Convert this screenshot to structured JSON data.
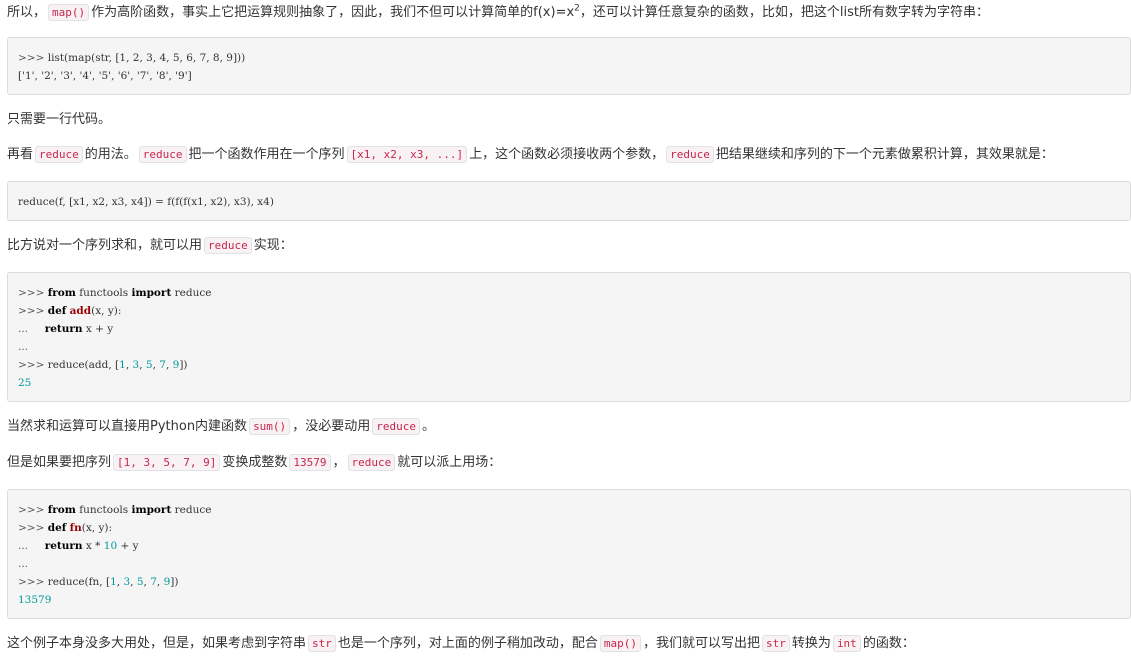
{
  "para1": {
    "a": "所以，",
    "code_map": "map()",
    "b": "作为高阶函数，事实上它把运算规则抽象了，因此，我们不但可以计算简单的f(x)=x",
    "sup": "2",
    "c": "，还可以计算任意复杂的函数，比如，把这个list所有数字转为字符串："
  },
  "code1": {
    "l1": {
      "p": ">>> ",
      "a": "list(map(str, [1, 2, 3, 4, 5, 6, 7, 8, 9]))"
    },
    "l2": "['1', '2', '3', '4', '5', '6', '7', '8', '9']"
  },
  "para2": "只需要一行代码。",
  "para3": {
    "a": "再看",
    "c1": "reduce",
    "b": "的用法。",
    "c2": "reduce",
    "c": "把一个函数作用在一个序列",
    "c3": "[x1, x2, x3, ...]",
    "d": "上，这个函数必须接收两个参数，",
    "c4": "reduce",
    "e": "把结果继续和序列的下一个元素做累积计算，其效果就是："
  },
  "code2": "reduce(f, [x1, x2, x3, x4]) = f(f(f(x1, x2), x3), x4)",
  "para4": {
    "a": "比方说对一个序列求和，就可以用",
    "c1": "reduce",
    "b": "实现："
  },
  "code3": {
    "l1": {
      "p": ">>> ",
      "kw1": "from",
      "m": " functools ",
      "kw2": "import",
      "e": " reduce"
    },
    "l2": {
      "p": ">>> ",
      "kw": "def",
      "fn": "add",
      "e": "(x, y):"
    },
    "l3": {
      "p": "...     ",
      "kw": "return",
      "e": " x + y"
    },
    "l4": {
      "p": "..."
    },
    "l5": {
      "p": ">>> ",
      "a": "reduce(add, [",
      "n1": "1",
      "s1": ", ",
      "n2": "3",
      "s2": ", ",
      "n3": "5",
      "s3": ", ",
      "n4": "7",
      "s4": ", ",
      "n5": "9",
      "e": "])"
    },
    "l6": "25"
  },
  "para5": {
    "a": "当然求和运算可以直接用Python内建函数",
    "c1": "sum()",
    "b": "，没必要动用",
    "c2": "reduce",
    "c": "。"
  },
  "para6": {
    "a": "但是如果要把序列",
    "c1": "[1, 3, 5, 7, 9]",
    "b": "变换成整数",
    "c2": "13579",
    "c": "，",
    "c3": "reduce",
    "d": "就可以派上用场："
  },
  "code4": {
    "l1": {
      "p": ">>> ",
      "kw1": "from",
      "m": " functools ",
      "kw2": "import",
      "e": " reduce"
    },
    "l2": {
      "p": ">>> ",
      "kw": "def",
      "fn": "fn",
      "e": "(x, y):"
    },
    "l3": {
      "p": "...     ",
      "kw": "return",
      "a": " x * ",
      "n": "10",
      "e": " + y"
    },
    "l4": {
      "p": "..."
    },
    "l5": {
      "p": ">>> ",
      "a": "reduce(fn, [",
      "n1": "1",
      "s1": ", ",
      "n2": "3",
      "s2": ", ",
      "n3": "5",
      "s3": ", ",
      "n4": "7",
      "s4": ", ",
      "n5": "9",
      "e": "])"
    },
    "l6": "13579"
  },
  "para7": {
    "a": "这个例子本身没多大用处，但是，如果考虑到字符串",
    "c1": "str",
    "b": "也是一个序列，对上面的例子稍加改动，配合",
    "c2": "map()",
    "c": "，我们就可以写出把",
    "c3": "str",
    "d": "转换为",
    "c4": "int",
    "e": "的函数："
  }
}
